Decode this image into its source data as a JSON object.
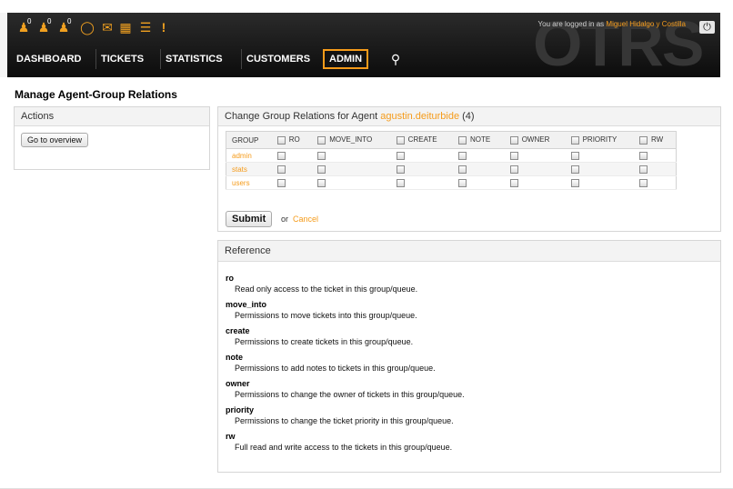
{
  "header": {
    "logo_watermark": "OTRS",
    "logged_in_prefix": "You are logged in as",
    "logged_in_user": "Miguel Hidalgo y Costilla",
    "toolbar": [
      {
        "icon": "locked-tickets-new-icon",
        "count": "0"
      },
      {
        "icon": "locked-tickets-reminder-icon",
        "count": "0"
      },
      {
        "icon": "locked-tickets-total-icon",
        "count": "0"
      },
      {
        "icon": "watched-tickets-icon",
        "count": ""
      },
      {
        "icon": "email-ticket-icon",
        "count": ""
      },
      {
        "icon": "phone-ticket-icon",
        "count": ""
      },
      {
        "icon": "queue-view-icon",
        "count": ""
      },
      {
        "icon": "escalation-view-icon",
        "count": ""
      }
    ],
    "nav": [
      "DASHBOARD",
      "TICKETS",
      "STATISTICS",
      "CUSTOMERS",
      "ADMIN"
    ],
    "active_nav": "ADMIN"
  },
  "page": {
    "title": "Manage Agent-Group Relations"
  },
  "actions": {
    "heading": "Actions",
    "overview_button": "Go to overview"
  },
  "relations": {
    "heading_prefix": "Change Group Relations for Agent",
    "agent": "agustin.deiturbide",
    "agent_id": "(4)",
    "columns": [
      "GROUP",
      "RO",
      "MOVE_INTO",
      "CREATE",
      "NOTE",
      "OWNER",
      "PRIORITY",
      "RW"
    ],
    "groups": [
      "admin",
      "stats",
      "users"
    ],
    "submit": "Submit",
    "or": "or",
    "cancel": "Cancel"
  },
  "reference": {
    "heading": "Reference",
    "items": [
      {
        "term": "ro",
        "desc": "Read only access to the ticket in this group/queue."
      },
      {
        "term": "move_into",
        "desc": "Permissions to move tickets into this group/queue."
      },
      {
        "term": "create",
        "desc": "Permissions to create tickets in this group/queue."
      },
      {
        "term": "note",
        "desc": "Permissions to add notes to tickets in this group/queue."
      },
      {
        "term": "owner",
        "desc": "Permissions to change the owner of tickets in this group/queue."
      },
      {
        "term": "priority",
        "desc": "Permissions to change the ticket priority in this group/queue."
      },
      {
        "term": "rw",
        "desc": "Full read and write access to the tickets in this group/queue."
      }
    ]
  },
  "colors": {
    "accent": "#f59b1a",
    "header_bg": "#1a1a1a"
  }
}
